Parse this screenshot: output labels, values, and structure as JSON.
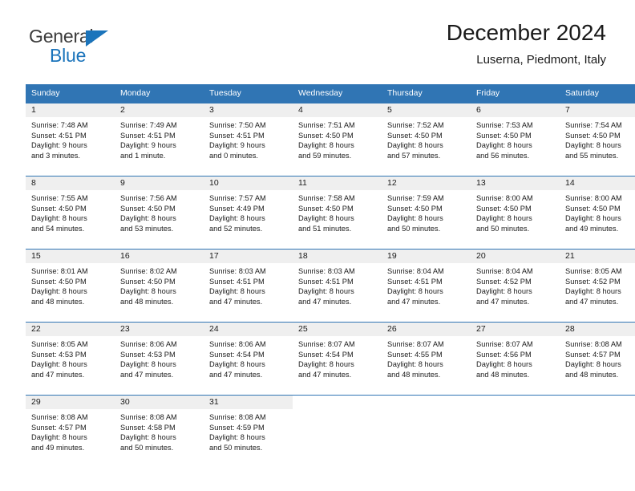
{
  "brand": {
    "name_top": "General",
    "name_bottom": "Blue",
    "accent_color": "#1b74bb"
  },
  "header": {
    "title": "December 2024",
    "subtitle": "Luserna, Piedmont, Italy"
  },
  "theme": {
    "header_bg": "#3075b4",
    "header_text": "#ffffff",
    "daynum_bg": "#efefef",
    "cell_bg": "#ffffff"
  },
  "weekday_headers": [
    "Sunday",
    "Monday",
    "Tuesday",
    "Wednesday",
    "Thursday",
    "Friday",
    "Saturday"
  ],
  "weeks": [
    [
      {
        "day": "1",
        "sunrise": "Sunrise: 7:48 AM",
        "sunset": "Sunset: 4:51 PM",
        "daylight_1": "Daylight: 9 hours",
        "daylight_2": "and 3 minutes."
      },
      {
        "day": "2",
        "sunrise": "Sunrise: 7:49 AM",
        "sunset": "Sunset: 4:51 PM",
        "daylight_1": "Daylight: 9 hours",
        "daylight_2": "and 1 minute."
      },
      {
        "day": "3",
        "sunrise": "Sunrise: 7:50 AM",
        "sunset": "Sunset: 4:51 PM",
        "daylight_1": "Daylight: 9 hours",
        "daylight_2": "and 0 minutes."
      },
      {
        "day": "4",
        "sunrise": "Sunrise: 7:51 AM",
        "sunset": "Sunset: 4:50 PM",
        "daylight_1": "Daylight: 8 hours",
        "daylight_2": "and 59 minutes."
      },
      {
        "day": "5",
        "sunrise": "Sunrise: 7:52 AM",
        "sunset": "Sunset: 4:50 PM",
        "daylight_1": "Daylight: 8 hours",
        "daylight_2": "and 57 minutes."
      },
      {
        "day": "6",
        "sunrise": "Sunrise: 7:53 AM",
        "sunset": "Sunset: 4:50 PM",
        "daylight_1": "Daylight: 8 hours",
        "daylight_2": "and 56 minutes."
      },
      {
        "day": "7",
        "sunrise": "Sunrise: 7:54 AM",
        "sunset": "Sunset: 4:50 PM",
        "daylight_1": "Daylight: 8 hours",
        "daylight_2": "and 55 minutes."
      }
    ],
    [
      {
        "day": "8",
        "sunrise": "Sunrise: 7:55 AM",
        "sunset": "Sunset: 4:50 PM",
        "daylight_1": "Daylight: 8 hours",
        "daylight_2": "and 54 minutes."
      },
      {
        "day": "9",
        "sunrise": "Sunrise: 7:56 AM",
        "sunset": "Sunset: 4:50 PM",
        "daylight_1": "Daylight: 8 hours",
        "daylight_2": "and 53 minutes."
      },
      {
        "day": "10",
        "sunrise": "Sunrise: 7:57 AM",
        "sunset": "Sunset: 4:49 PM",
        "daylight_1": "Daylight: 8 hours",
        "daylight_2": "and 52 minutes."
      },
      {
        "day": "11",
        "sunrise": "Sunrise: 7:58 AM",
        "sunset": "Sunset: 4:50 PM",
        "daylight_1": "Daylight: 8 hours",
        "daylight_2": "and 51 minutes."
      },
      {
        "day": "12",
        "sunrise": "Sunrise: 7:59 AM",
        "sunset": "Sunset: 4:50 PM",
        "daylight_1": "Daylight: 8 hours",
        "daylight_2": "and 50 minutes."
      },
      {
        "day": "13",
        "sunrise": "Sunrise: 8:00 AM",
        "sunset": "Sunset: 4:50 PM",
        "daylight_1": "Daylight: 8 hours",
        "daylight_2": "and 50 minutes."
      },
      {
        "day": "14",
        "sunrise": "Sunrise: 8:00 AM",
        "sunset": "Sunset: 4:50 PM",
        "daylight_1": "Daylight: 8 hours",
        "daylight_2": "and 49 minutes."
      }
    ],
    [
      {
        "day": "15",
        "sunrise": "Sunrise: 8:01 AM",
        "sunset": "Sunset: 4:50 PM",
        "daylight_1": "Daylight: 8 hours",
        "daylight_2": "and 48 minutes."
      },
      {
        "day": "16",
        "sunrise": "Sunrise: 8:02 AM",
        "sunset": "Sunset: 4:50 PM",
        "daylight_1": "Daylight: 8 hours",
        "daylight_2": "and 48 minutes."
      },
      {
        "day": "17",
        "sunrise": "Sunrise: 8:03 AM",
        "sunset": "Sunset: 4:51 PM",
        "daylight_1": "Daylight: 8 hours",
        "daylight_2": "and 47 minutes."
      },
      {
        "day": "18",
        "sunrise": "Sunrise: 8:03 AM",
        "sunset": "Sunset: 4:51 PM",
        "daylight_1": "Daylight: 8 hours",
        "daylight_2": "and 47 minutes."
      },
      {
        "day": "19",
        "sunrise": "Sunrise: 8:04 AM",
        "sunset": "Sunset: 4:51 PM",
        "daylight_1": "Daylight: 8 hours",
        "daylight_2": "and 47 minutes."
      },
      {
        "day": "20",
        "sunrise": "Sunrise: 8:04 AM",
        "sunset": "Sunset: 4:52 PM",
        "daylight_1": "Daylight: 8 hours",
        "daylight_2": "and 47 minutes."
      },
      {
        "day": "21",
        "sunrise": "Sunrise: 8:05 AM",
        "sunset": "Sunset: 4:52 PM",
        "daylight_1": "Daylight: 8 hours",
        "daylight_2": "and 47 minutes."
      }
    ],
    [
      {
        "day": "22",
        "sunrise": "Sunrise: 8:05 AM",
        "sunset": "Sunset: 4:53 PM",
        "daylight_1": "Daylight: 8 hours",
        "daylight_2": "and 47 minutes."
      },
      {
        "day": "23",
        "sunrise": "Sunrise: 8:06 AM",
        "sunset": "Sunset: 4:53 PM",
        "daylight_1": "Daylight: 8 hours",
        "daylight_2": "and 47 minutes."
      },
      {
        "day": "24",
        "sunrise": "Sunrise: 8:06 AM",
        "sunset": "Sunset: 4:54 PM",
        "daylight_1": "Daylight: 8 hours",
        "daylight_2": "and 47 minutes."
      },
      {
        "day": "25",
        "sunrise": "Sunrise: 8:07 AM",
        "sunset": "Sunset: 4:54 PM",
        "daylight_1": "Daylight: 8 hours",
        "daylight_2": "and 47 minutes."
      },
      {
        "day": "26",
        "sunrise": "Sunrise: 8:07 AM",
        "sunset": "Sunset: 4:55 PM",
        "daylight_1": "Daylight: 8 hours",
        "daylight_2": "and 48 minutes."
      },
      {
        "day": "27",
        "sunrise": "Sunrise: 8:07 AM",
        "sunset": "Sunset: 4:56 PM",
        "daylight_1": "Daylight: 8 hours",
        "daylight_2": "and 48 minutes."
      },
      {
        "day": "28",
        "sunrise": "Sunrise: 8:08 AM",
        "sunset": "Sunset: 4:57 PM",
        "daylight_1": "Daylight: 8 hours",
        "daylight_2": "and 48 minutes."
      }
    ],
    [
      {
        "day": "29",
        "sunrise": "Sunrise: 8:08 AM",
        "sunset": "Sunset: 4:57 PM",
        "daylight_1": "Daylight: 8 hours",
        "daylight_2": "and 49 minutes."
      },
      {
        "day": "30",
        "sunrise": "Sunrise: 8:08 AM",
        "sunset": "Sunset: 4:58 PM",
        "daylight_1": "Daylight: 8 hours",
        "daylight_2": "and 50 minutes."
      },
      {
        "day": "31",
        "sunrise": "Sunrise: 8:08 AM",
        "sunset": "Sunset: 4:59 PM",
        "daylight_1": "Daylight: 8 hours",
        "daylight_2": "and 50 minutes."
      },
      {
        "day": "",
        "sunrise": "",
        "sunset": "",
        "daylight_1": "",
        "daylight_2": ""
      },
      {
        "day": "",
        "sunrise": "",
        "sunset": "",
        "daylight_1": "",
        "daylight_2": ""
      },
      {
        "day": "",
        "sunrise": "",
        "sunset": "",
        "daylight_1": "",
        "daylight_2": ""
      },
      {
        "day": "",
        "sunrise": "",
        "sunset": "",
        "daylight_1": "",
        "daylight_2": ""
      }
    ]
  ]
}
